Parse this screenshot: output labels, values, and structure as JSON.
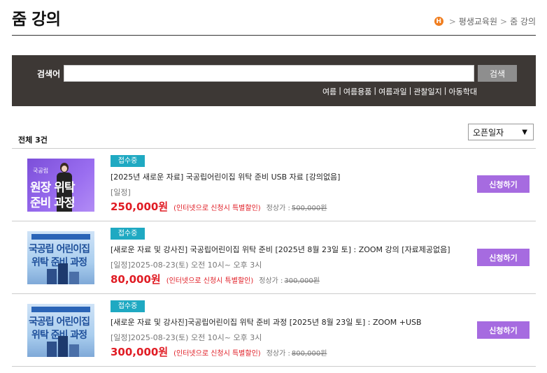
{
  "page": {
    "title": "줌 강의"
  },
  "breadcrumb": {
    "home_icon": "H",
    "items": [
      "평생교육원",
      "줌 강의"
    ]
  },
  "search": {
    "label": "검색어",
    "value": "",
    "placeholder": "",
    "button_label": "검색",
    "keywords": [
      "여름",
      "여름용품",
      "여름과일",
      "관찰일지",
      "아동학대"
    ]
  },
  "list": {
    "total_label": "전체",
    "total_count": "3건",
    "sort_selected": "오픈일자"
  },
  "courses": [
    {
      "status": "접수중",
      "title": "[2025년 새로운 자료] 국공립어린이집 위탁 준비 USB 자료 [강의없음]",
      "schedule": "[일정]",
      "price": "250,000원",
      "discount_note": "(인터넷으로 신청시 특별할인)",
      "regular_label": "정상가 :",
      "regular_price": "500,000원",
      "apply_label": "신청하기",
      "thumb": {
        "small": "국공립",
        "line1": "원장  위탁",
        "line2": "준비  과정"
      }
    },
    {
      "status": "접수중",
      "title": "[새로운 자료 및 강사진] 국공립어린이집 위탁 준비 [2025년 8월 23일 토] : ZOOM 강의 [자료제공없음]",
      "schedule": "[일정]2025-08-23(토) 오전 10시~ 오후 3시",
      "price": "80,000원",
      "discount_note": "(인터넷으로 신청시 특별할인)",
      "regular_label": "정상가 :",
      "regular_price": "300,000원",
      "apply_label": "신청하기",
      "thumb": {
        "line1": "국공립 어린이집",
        "line2": "위탁 준비 과정"
      }
    },
    {
      "status": "접수중",
      "title": "[새로운 자료 및 강사진]국공립어린이집 위탁 준비 과정 [2025년 8월 23일 토] : ZOOM +USB",
      "schedule": "[일정]2025-08-23(토) 오전 10시~ 오후 3시",
      "price": "300,000원",
      "discount_note": "(인터넷으로 신청시 특별할인)",
      "regular_label": "정상가 :",
      "regular_price": "800,000원",
      "apply_label": "신청하기",
      "thumb": {
        "line1": "국공립 어린이집",
        "line2": "위탁 준비 과정"
      }
    }
  ],
  "colors": {
    "search_panel_bg": "#3d3835",
    "badge_bg": "#1fa9c2",
    "price_red": "#e01c24",
    "apply_button_bg": "#a66be0",
    "home_icon_bg": "#f07d1e"
  },
  "icons": {
    "home": "home-icon",
    "sort_chevron": "chevron-down-icon"
  }
}
